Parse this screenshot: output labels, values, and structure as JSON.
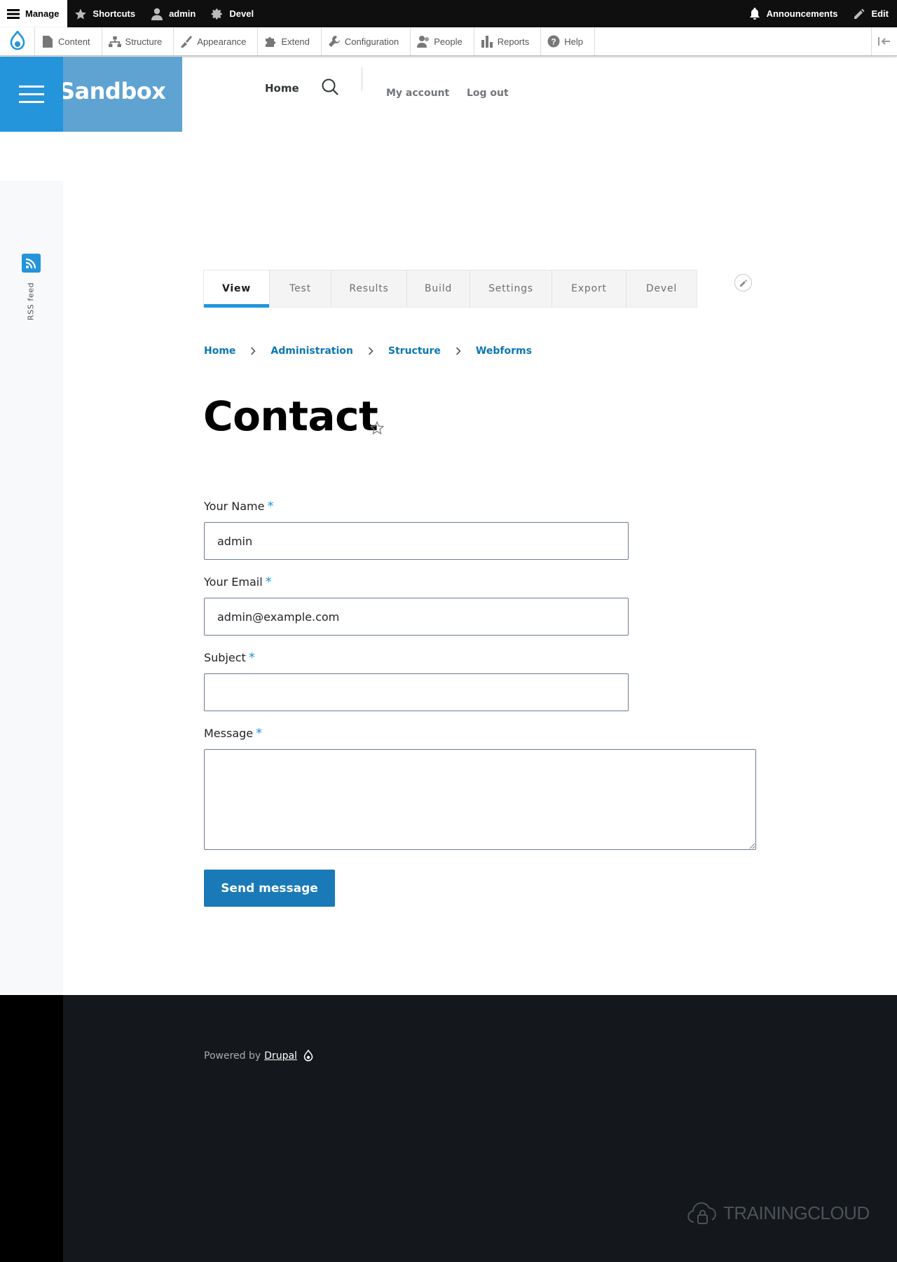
{
  "toolbar": {
    "manage": "Manage",
    "shortcuts": "Shortcuts",
    "user": "admin",
    "devel": "Devel",
    "announcements": "Announcements",
    "edit": "Edit"
  },
  "tray": {
    "items": [
      "Content",
      "Structure",
      "Appearance",
      "Extend",
      "Configuration",
      "People",
      "Reports",
      "Help"
    ]
  },
  "site": {
    "name": "Sandbox",
    "nav_home": "Home",
    "my_account": "My account",
    "log_out": "Log out",
    "rss_label": "RSS feed"
  },
  "tabs": [
    "View",
    "Test",
    "Results",
    "Build",
    "Settings",
    "Export",
    "Devel"
  ],
  "breadcrumb": [
    "Home",
    "Administration",
    "Structure",
    "Webforms"
  ],
  "page": {
    "title": "Contact"
  },
  "form": {
    "name_label": "Your Name",
    "name_value": "admin",
    "email_label": "Your Email",
    "email_value": "admin@example.com",
    "subject_label": "Subject",
    "subject_value": "",
    "message_label": "Message",
    "message_value": "",
    "required_marker": "*",
    "submit": "Send message"
  },
  "footer": {
    "powered_by": "Powered by",
    "drupal_link": "Drupal",
    "brand": "TRAININGCLOUD"
  },
  "colors": {
    "accent": "#2494db",
    "link": "#0d77b5",
    "button": "#1a7ab8",
    "toolbar": "#0f0f0f",
    "footer": "#14171b"
  }
}
